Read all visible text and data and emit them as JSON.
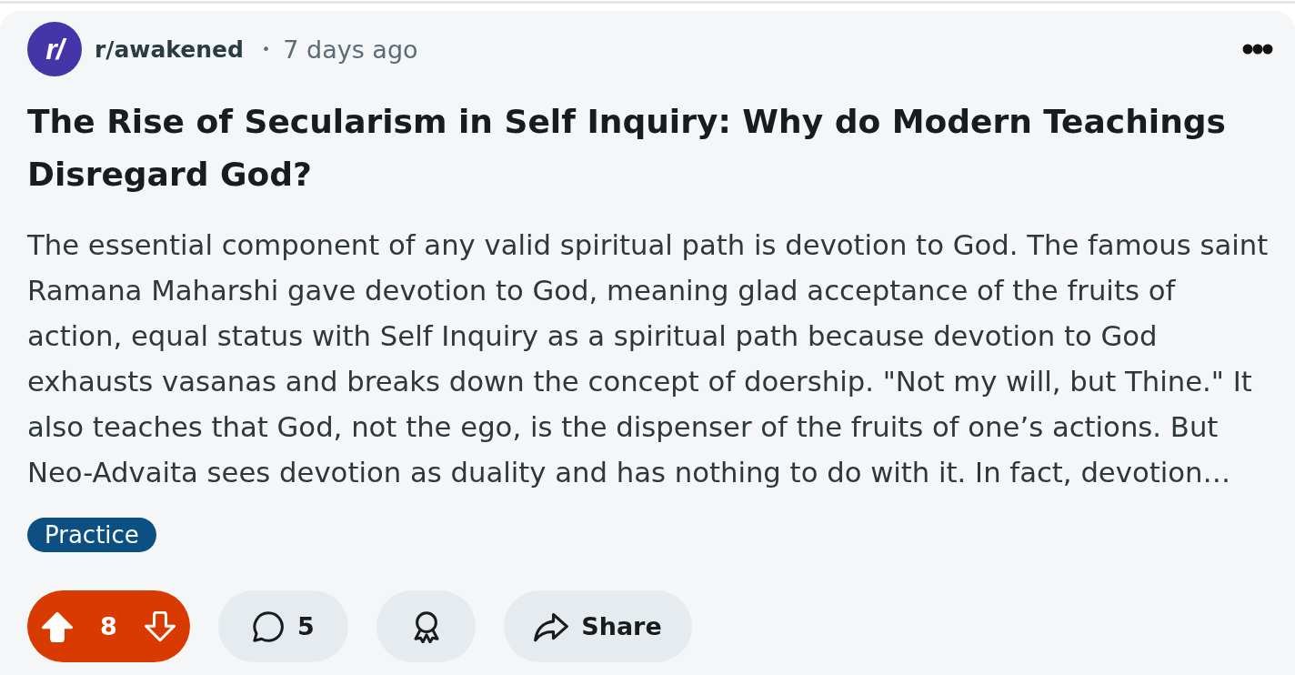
{
  "post": {
    "avatar_text": "r/",
    "subreddit": "r/awakened",
    "separator": "•",
    "time": "7 days ago",
    "title": "The Rise of Secularism in Self Inquiry: Why do Modern Teachings Disregard God?",
    "body": "The essential component of any valid spiritual path is devotion to God. The famous saint\nRamana Maharshi gave devotion to God, meaning glad acceptance of the fruits of\naction, equal status with Self Inquiry as a spiritual path because devotion to God\nexhausts vasanas and breaks down the concept of doership. \"Not my will, but Thine.\" It\nalso teaches that God, not the ego, is the dispenser of the fruits of one’s actions. But\nNeo-Advaita sees devotion as duality and has nothing to do with it. In fact, devotion…",
    "flair": "Practice"
  },
  "actions": {
    "upvoted": true,
    "downvoted": false,
    "score": "8",
    "comments": "5",
    "share": "Share"
  }
}
